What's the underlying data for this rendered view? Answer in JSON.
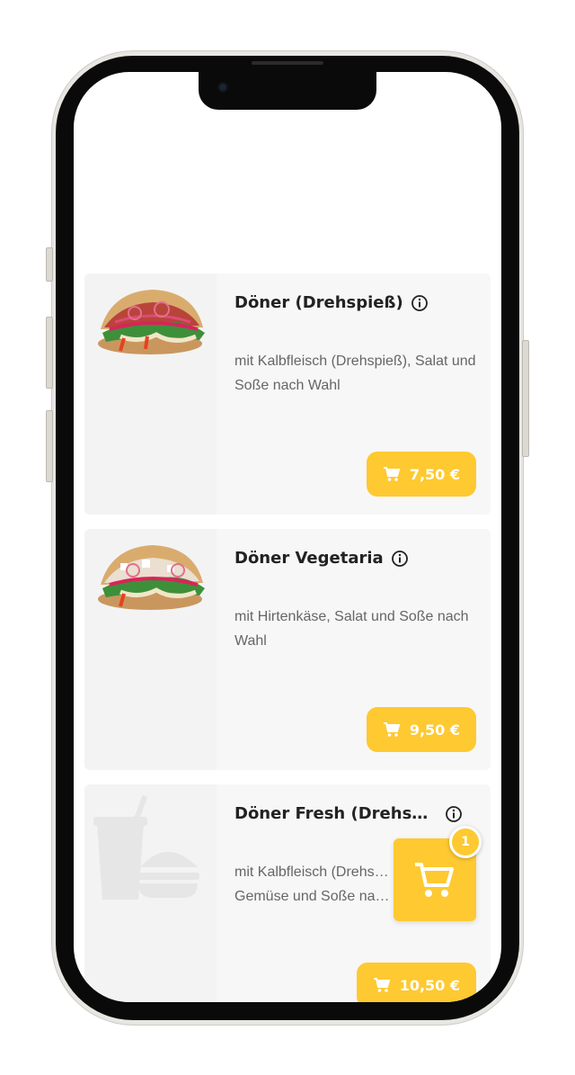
{
  "menu": {
    "items": [
      {
        "title": "Döner (Drehspieß)",
        "description": "mit Kalbfleisch (Drehspieß), Salat und Soße nach Wahl",
        "price": "7,50 €",
        "image": "doner-sandwich-photo"
      },
      {
        "title": "Döner Vegetaria",
        "description": "mit Hirtenkäse, Salat und Soße nach Wahl",
        "price": "9,50 €",
        "image": "doner-sandwich-photo"
      },
      {
        "title": "Döner Fresh (Drehspi…",
        "description": "mit Kalbfleisch (Drehs… Gemüse und Soße na…",
        "price": "10,50 €",
        "image": "placeholder-drink-burger-icon"
      }
    ]
  },
  "cart": {
    "count": "1",
    "icon": "shopping-cart-icon"
  },
  "colors": {
    "accent": "#fec931",
    "card_bg": "#f7f7f7",
    "title": "#222222",
    "text": "#666666"
  }
}
